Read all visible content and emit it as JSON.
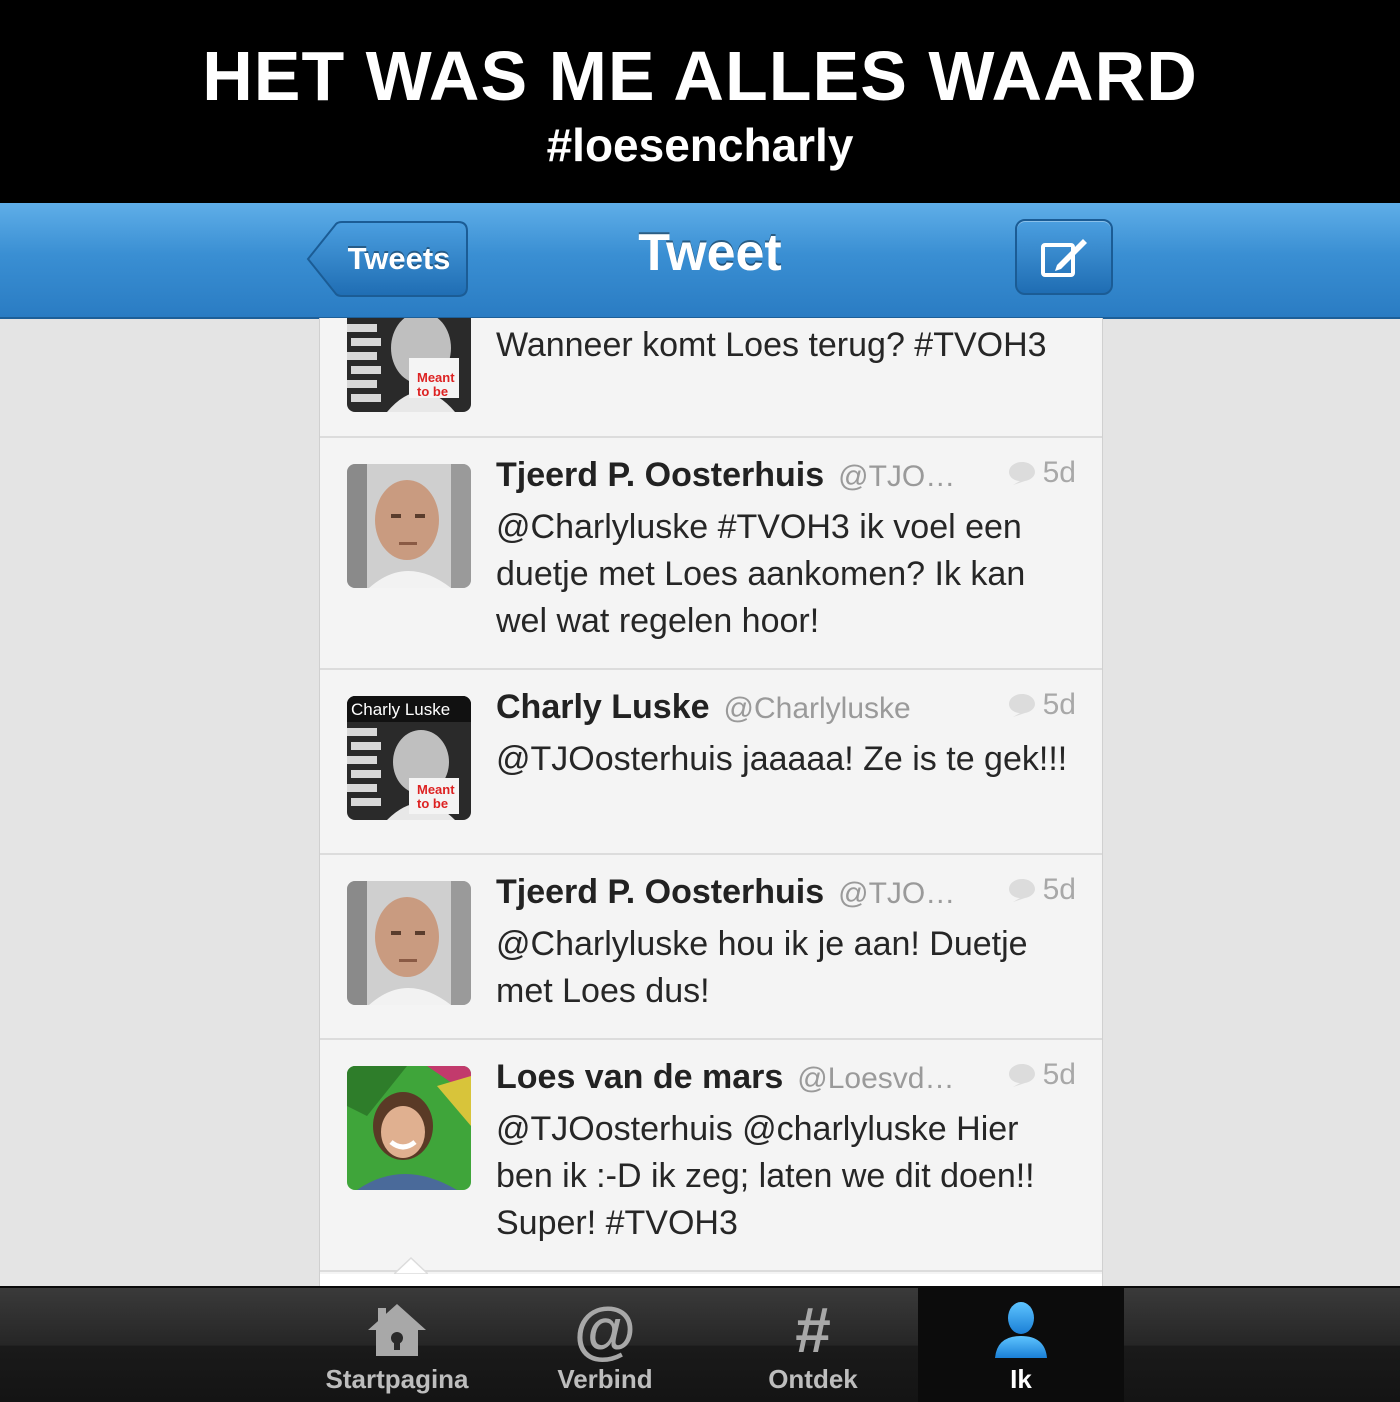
{
  "banner": {
    "title": "HET WAS ME ALLES WAARD",
    "subtitle": "#loesencharly"
  },
  "nav": {
    "back_label": "Tweets",
    "title": "Tweet",
    "compose_icon": "compose-icon",
    "accent": "#3a8fd3"
  },
  "tweets": [
    {
      "name": "",
      "handle": "",
      "time": "",
      "text": "Wanneer komt Loes terug? #TVOH3",
      "avatar_text": "",
      "avatar_sub1": "Meant",
      "avatar_sub2": "to be"
    },
    {
      "name": "Tjeerd P. Oosterhuis",
      "handle": "@TJO…",
      "time": "5d",
      "text": "@Charlyluske #TVOH3 ik voel een duetje met Loes aankomen? Ik kan wel wat regelen hoor!"
    },
    {
      "name": "Charly Luske",
      "handle": "@Charlyluske",
      "time": "5d",
      "text": "@TJOosterhuis jaaaaa! Ze is te gek!!!",
      "avatar_text": "Charly Luske",
      "avatar_sub1": "Meant",
      "avatar_sub2": "to be"
    },
    {
      "name": "Tjeerd P. Oosterhuis",
      "handle": "@TJO…",
      "time": "5d",
      "text": "@Charlyluske hou ik je aan! Duetje met Loes dus!"
    },
    {
      "name": "Loes van de mars",
      "handle": "@Loesvd…",
      "time": "5d",
      "text": "@TJOosterhuis @charlyluske Hier ben ik :-D ik zeg; laten we dit doen!! Super! #TVOH3"
    }
  ],
  "tabbar": {
    "tabs": [
      {
        "label": "Startpagina",
        "icon": "home-icon"
      },
      {
        "label": "Verbind",
        "icon": "at-icon"
      },
      {
        "label": "Ontdek",
        "icon": "hash-icon"
      },
      {
        "label": "Ik",
        "icon": "person-icon",
        "active": true
      }
    ]
  }
}
